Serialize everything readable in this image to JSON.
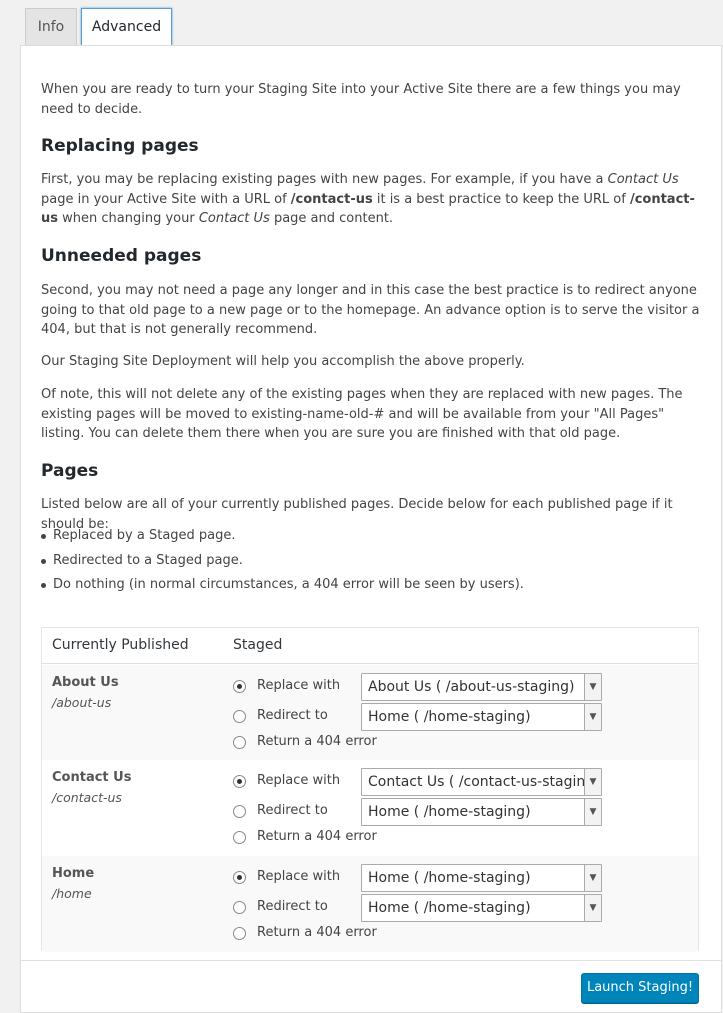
{
  "tabs": [
    {
      "label": "Info",
      "active": false
    },
    {
      "label": "Advanced",
      "active": true
    }
  ],
  "intro": "When you are ready to turn your Staging Site into your Active Site there are a few things you may need to decide.",
  "sections": {
    "replacing": {
      "heading": "Replacing pages",
      "text": "First, you may be replacing existing pages with new pages. For example, if you have a Contact Us page in your Active Site with a URL of /contact-us it is a best practice to keep the URL of /contact-us when changing your Contact Us page and content."
    },
    "unneeded": {
      "heading": "Unneeded pages",
      "text": "Second, you may not need a page any longer and in this case the best practice is to redirect anyone going to that old page to a new page or to the homepage. An advance option is to serve the visitor a 404, but that is not generally recommend."
    },
    "deploy": "Our Staging Site Deployment will help you accomplish the above properly.",
    "note": "Of note, this will not delete any of the existing pages when they are replaced with new pages. The existing pages will be moved to existing-name-old-# and will be available from your \"All Pages\" listing. You can delete them there when you are sure you are finished with that old page.",
    "pages": {
      "heading": "Pages",
      "text": "Listed below are all of your currently published pages. Decide below for each published page if it should be:",
      "options": [
        "Replaced by a Staged page.",
        "Redirected to a Staged page.",
        "Do nothing (in normal circumstances, a 404 error will be seen by users)."
      ]
    }
  },
  "table": {
    "headers": {
      "published": "Currently Published",
      "staged": "Staged"
    },
    "radio_labels": {
      "replace": "Replace with",
      "redirect": "Redirect to",
      "error": "Return a 404 error"
    },
    "rows": [
      {
        "title": "About Us",
        "slug": "/about-us",
        "replace_value": "About Us ( /about-us-staging)",
        "redirect_value": "Home ( /home-staging)",
        "selected": "replace"
      },
      {
        "title": "Contact Us",
        "slug": "/contact-us",
        "replace_value": "Contact Us ( /contact-us-staging)",
        "redirect_value": "Home ( /home-staging)",
        "selected": "replace"
      },
      {
        "title": "Home",
        "slug": "/home",
        "replace_value": "Home ( /home-staging)",
        "redirect_value": "Home ( /home-staging)",
        "selected": "replace"
      }
    ]
  },
  "launch_label": "Launch Staging!"
}
